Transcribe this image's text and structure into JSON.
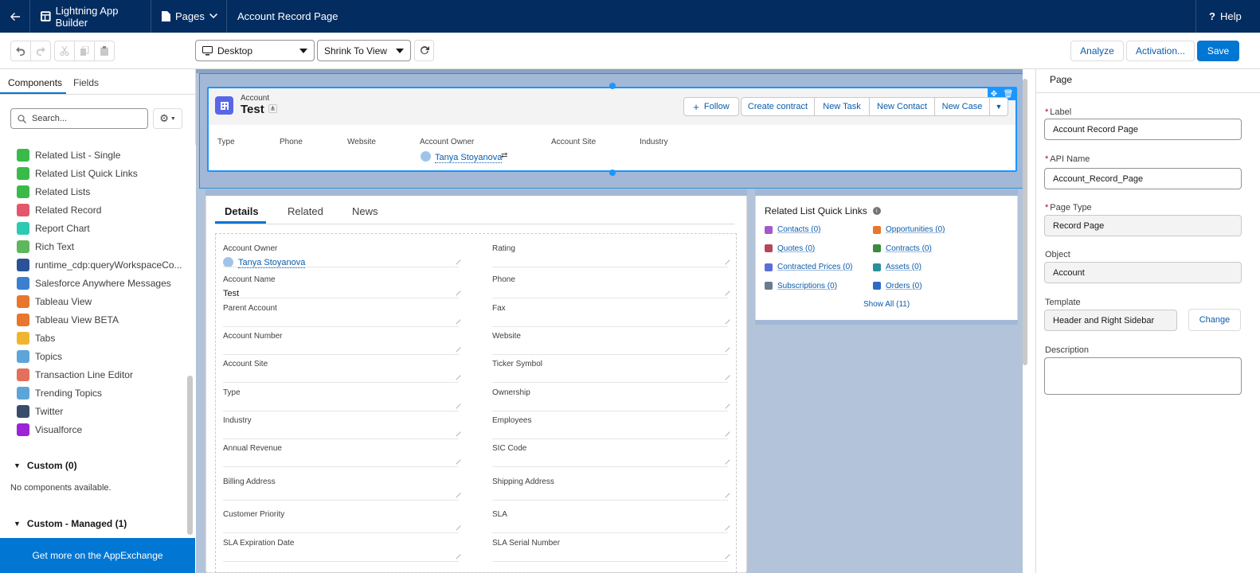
{
  "topbar": {
    "app_title": "Lightning App Builder",
    "pages_label": "Pages",
    "page_name": "Account Record Page",
    "help_label": "Help"
  },
  "toolbar": {
    "device_select": "Desktop",
    "view_select": "Shrink To View",
    "analyze_label": "Analyze",
    "activation_label": "Activation...",
    "save_label": "Save"
  },
  "left_panel": {
    "tabs": [
      "Components",
      "Fields"
    ],
    "search_placeholder": "Search...",
    "components": [
      {
        "label": "Related List - Single",
        "color": "#3bba4c"
      },
      {
        "label": "Related List Quick Links",
        "color": "#3bba4c"
      },
      {
        "label": "Related Lists",
        "color": "#3bba4c"
      },
      {
        "label": "Related Record",
        "color": "#e3566b"
      },
      {
        "label": "Report Chart",
        "color": "#2dc9b5"
      },
      {
        "label": "Rich Text",
        "color": "#5db85b"
      },
      {
        "label": "runtime_cdp:queryWorkspaceCo...",
        "color": "#2a5297"
      },
      {
        "label": "Salesforce Anywhere Messages",
        "color": "#3c7fd0"
      },
      {
        "label": "Tableau View",
        "color": "#e8762c"
      },
      {
        "label": "Tableau View BETA",
        "color": "#e8762c"
      },
      {
        "label": "Tabs",
        "color": "#f0b530"
      },
      {
        "label": "Topics",
        "color": "#5da5d8"
      },
      {
        "label": "Transaction Line Editor",
        "color": "#e3705b"
      },
      {
        "label": "Trending Topics",
        "color": "#5da5d8"
      },
      {
        "label": "Twitter",
        "color": "#3a4c6b"
      },
      {
        "label": "Visualforce",
        "color": "#9b24d6"
      }
    ],
    "custom_section": "Custom (0)",
    "no_components": "No components available.",
    "custom_managed_section": "Custom - Managed (1)",
    "appexchange_label": "Get more on the AppExchange"
  },
  "record_header": {
    "object_label": "Account",
    "record_name": "Test",
    "actions": [
      "Follow",
      "Create contract",
      "New Task",
      "New Contact",
      "New Case"
    ],
    "highlights": [
      "Type",
      "Phone",
      "Website",
      "Account Owner",
      "Account Site",
      "Industry"
    ],
    "owner_name": "Tanya Stoyanova"
  },
  "detail_tabs": [
    "Details",
    "Related",
    "News"
  ],
  "detail_fields": {
    "left": [
      {
        "label": "Account Owner",
        "value": "Tanya Stoyanova"
      },
      {
        "label": "Account Name",
        "value": "Test"
      },
      {
        "label": "Parent Account",
        "value": ""
      },
      {
        "label": "Account Number",
        "value": ""
      },
      {
        "label": "Account Site",
        "value": ""
      },
      {
        "label": "Type",
        "value": ""
      },
      {
        "label": "Industry",
        "value": ""
      },
      {
        "label": "Annual Revenue",
        "value": ""
      },
      {
        "label": "Billing Address",
        "value": ""
      },
      {
        "label": "Customer Priority",
        "value": ""
      },
      {
        "label": "SLA Expiration Date",
        "value": ""
      }
    ],
    "right": [
      {
        "label": "Rating",
        "value": ""
      },
      {
        "label": "Phone",
        "value": ""
      },
      {
        "label": "Fax",
        "value": ""
      },
      {
        "label": "Website",
        "value": ""
      },
      {
        "label": "Ticker Symbol",
        "value": ""
      },
      {
        "label": "Ownership",
        "value": ""
      },
      {
        "label": "Employees",
        "value": ""
      },
      {
        "label": "SIC Code",
        "value": ""
      },
      {
        "label": "Shipping Address",
        "value": ""
      },
      {
        "label": "SLA",
        "value": ""
      },
      {
        "label": "SLA Serial Number",
        "value": ""
      }
    ]
  },
  "quick_links": {
    "title": "Related List Quick Links",
    "links": [
      {
        "label": "Contacts (0)",
        "color": "#a259c9"
      },
      {
        "label": "Opportunities (0)",
        "color": "#e8762c"
      },
      {
        "label": "Quotes (0)",
        "color": "#b5475b"
      },
      {
        "label": "Contracts (0)",
        "color": "#3c8a3d"
      },
      {
        "label": "Contracted Prices (0)",
        "color": "#5b6fd6"
      },
      {
        "label": "Assets (0)",
        "color": "#2a8f9a"
      },
      {
        "label": "Subscriptions (0)",
        "color": "#6b7a8f"
      },
      {
        "label": "Orders (0)",
        "color": "#2e6ac2"
      }
    ],
    "show_all": "Show All (11)"
  },
  "properties": {
    "heading": "Page",
    "label_label": "Label",
    "label_value": "Account Record Page",
    "api_name_label": "API Name",
    "api_name_value": "Account_Record_Page",
    "page_type_label": "Page Type",
    "page_type_value": "Record Page",
    "object_label": "Object",
    "object_value": "Account",
    "template_label": "Template",
    "template_value": "Header and Right Sidebar",
    "change_label": "Change",
    "description_label": "Description",
    "description_value": ""
  }
}
